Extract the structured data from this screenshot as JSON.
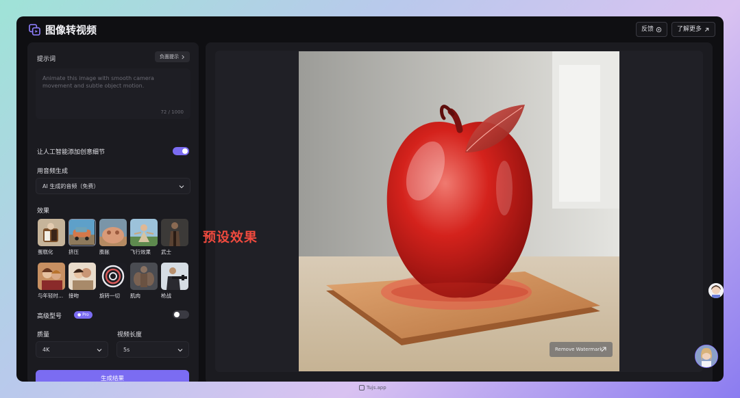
{
  "app": {
    "title": "图像转视频",
    "feedback_label": "反馈",
    "learn_more_label": "了解更多"
  },
  "prompt": {
    "label": "提示词",
    "negative_button": "负面提示",
    "placeholder": "Animate this image with smooth camera movement and subtle object motion.",
    "char_count": "72 / 1000"
  },
  "ai_details": {
    "label": "让人工智能添加创意细节",
    "enabled": true
  },
  "audio": {
    "label": "用音频生成",
    "selected": "AI 生成的音频（免费）"
  },
  "effects": {
    "label": "效果",
    "selected_index": 1,
    "items": [
      {
        "label": "蛋糕化"
      },
      {
        "label": "挤压"
      },
      {
        "label": "膨胀"
      },
      {
        "label": "飞行效果"
      },
      {
        "label": "武士"
      },
      {
        "label": "与年轻时..."
      },
      {
        "label": "接吻"
      },
      {
        "label": "旋转一切"
      },
      {
        "label": "肌肉"
      },
      {
        "label": "枪战"
      }
    ]
  },
  "annotation": {
    "callout": "预设效果",
    "color": "#f04a3e"
  },
  "advanced": {
    "label": "高级型号",
    "badge": "Pro",
    "enabled": false
  },
  "quality": {
    "label": "质量",
    "selected": "4K"
  },
  "duration": {
    "label": "视频长度",
    "selected": "5s"
  },
  "generate": {
    "label": "生成结果"
  },
  "preview": {
    "remove_watermark": "Remove Watermark"
  },
  "footer": {
    "brand": "Tujs.app"
  },
  "colors": {
    "accent": "#7b6cf2",
    "background": "#0f0f12",
    "panel": "#1b1b20"
  }
}
